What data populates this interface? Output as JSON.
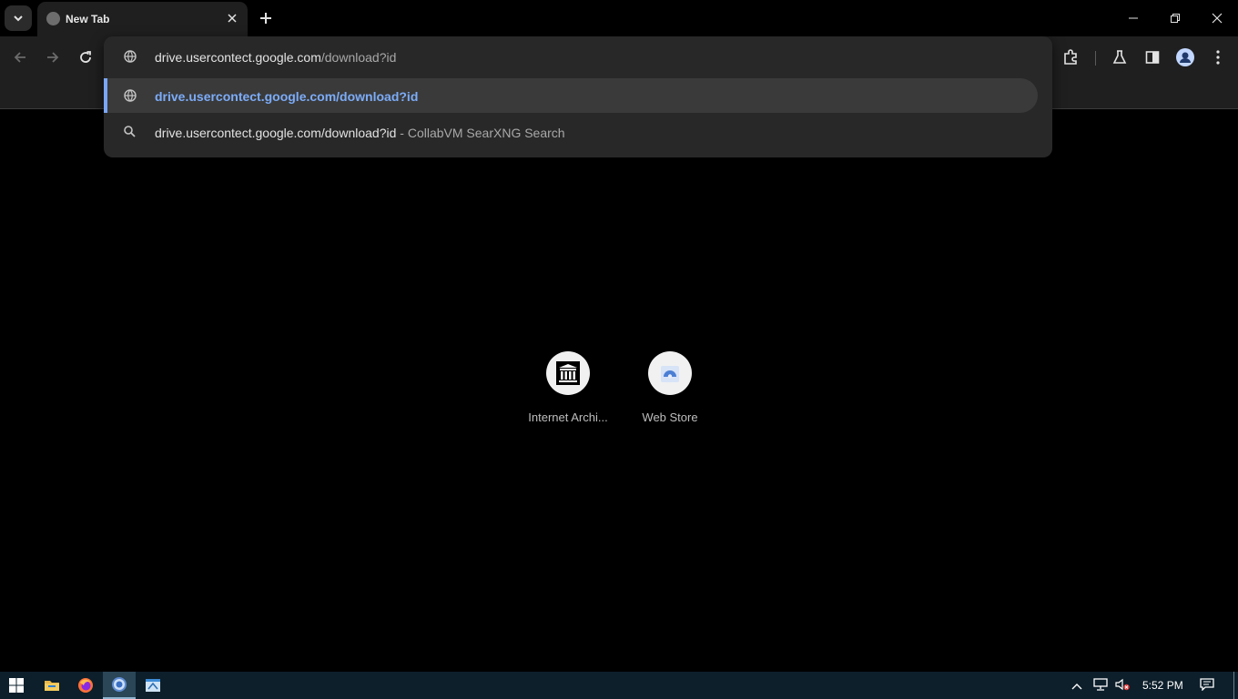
{
  "tab": {
    "title": "New Tab"
  },
  "omnibox": {
    "input_host": "drive.usercontect.google.com",
    "input_path": "/download?id",
    "suggestions": [
      {
        "text": "drive.usercontect.google.com/download?id",
        "selected": true
      },
      {
        "text": "drive.usercontect.google.com/download?id",
        "separator": " - ",
        "source": "CollabVM SearXNG Search"
      }
    ]
  },
  "shortcuts": [
    {
      "label": "Internet Archi...",
      "icon": "archive-icon"
    },
    {
      "label": "Web Store",
      "icon": "web-store-icon"
    }
  ],
  "taskbar": {
    "time": "5:52 PM"
  },
  "colors": {
    "accent": "#7cacf8",
    "background": "#000000",
    "toolbar": "#1f1f1f"
  }
}
